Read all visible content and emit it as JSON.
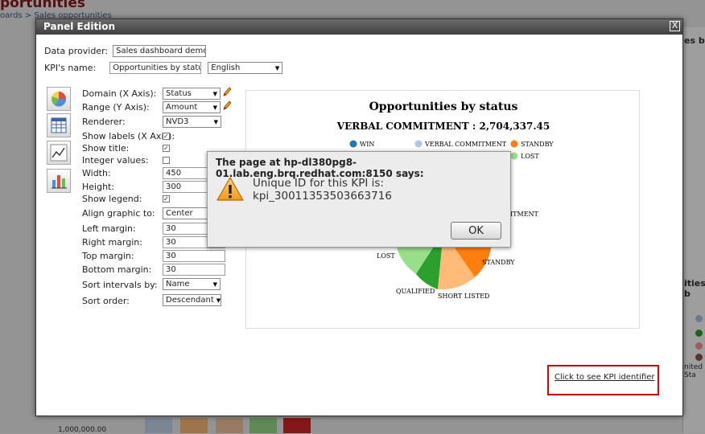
{
  "background": {
    "page_title": "portunities",
    "breadcrumb": "oards > Sales opportunities",
    "right_title_top": "es b",
    "right_title_mid": "ities b",
    "right_label": "nited Sta",
    "axis_label": "1,000,000.00"
  },
  "dialog": {
    "title": "Panel Edition",
    "close_label": "X",
    "data_provider_label": "Data provider:",
    "data_provider_value": "Sales dashboard demo",
    "kpi_name_label": "KPI's name:",
    "kpi_name_value": "Opportunities by status",
    "language_value": "English",
    "fields": [
      {
        "label": "Domain (X Axis):",
        "value": "Status"
      },
      {
        "label": "Range (Y Axis):",
        "value": "Amount"
      },
      {
        "label": "Renderer:",
        "value": "NVD3"
      },
      {
        "label": "Show labels (X Axis):"
      },
      {
        "label": "Show title:"
      },
      {
        "label": "Integer values:"
      },
      {
        "label": "Width:",
        "value": "450"
      },
      {
        "label": "Height:",
        "value": "300"
      },
      {
        "label": "Show legend:"
      },
      {
        "label": "Align graphic to:",
        "value": "Center"
      },
      {
        "label": "Left margin:",
        "value": "30"
      },
      {
        "label": "Right margin:",
        "value": "30"
      },
      {
        "label": "Top margin:",
        "value": "30"
      },
      {
        "label": "Bottom margin:",
        "value": "30"
      },
      {
        "label": "Sort intervals by:",
        "value": "Name"
      },
      {
        "label": "Sort order:",
        "value": "Descendant"
      }
    ],
    "kpi_link": "Click to see KPI identifier",
    "icons": [
      "pie-chart-icon",
      "table-chart-icon",
      "line-chart-icon",
      "bar-chart-icon"
    ]
  },
  "chart_data": {
    "type": "pie",
    "title": "Opportunities by status",
    "subtitle": "VERBAL COMMITMENT : 2,704,337.45",
    "legend": [
      {
        "name": "WIN",
        "color": "#1f77b4"
      },
      {
        "name": "VERBAL COMMITMENT",
        "color": "#aec7e8"
      },
      {
        "name": "STANDBY",
        "color": "#ff7f0e"
      },
      {
        "name": "LOST",
        "color": "#98df8a"
      }
    ],
    "visible_slice_labels": [
      "LOST",
      "QUALIFIED",
      "SHORT LISTED",
      "STANDBY",
      "ITMENT"
    ],
    "slice_colors": {
      "LOST": "#98df8a",
      "QUALIFIED": "#2ca02c",
      "SHORT LISTED": "#ffbb78",
      "STANDBY": "#ff7f0e"
    }
  },
  "alert": {
    "title": "The page at hp-dl380pg8-01.lab.eng.brq.redhat.com:8150 says:",
    "message": "Unique ID for this KPI is: kpi_30011353503663716",
    "ok_label": "OK",
    "icon": "warning-icon"
  }
}
